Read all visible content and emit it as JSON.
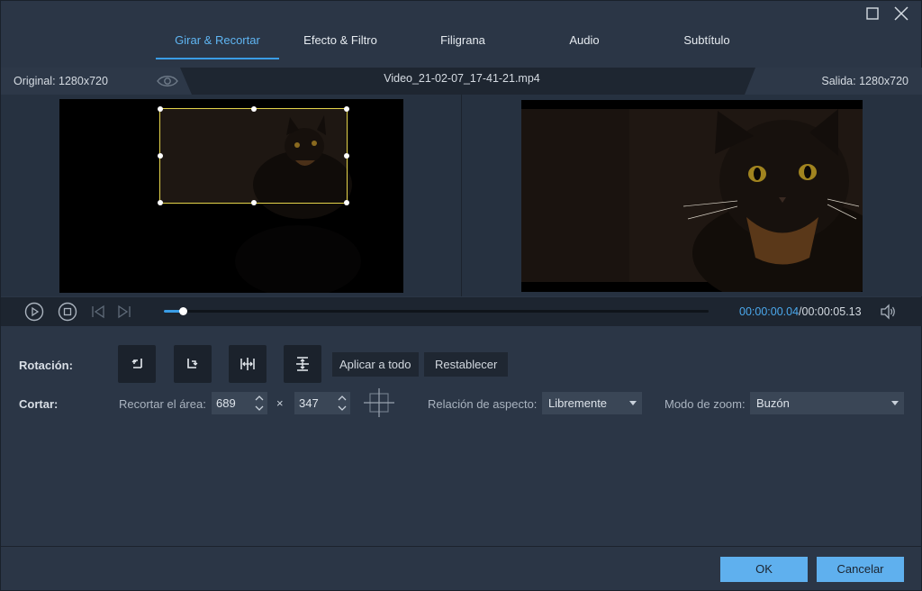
{
  "window": {
    "maximize_icon": "maximize-icon",
    "close_icon": "close-icon"
  },
  "tabs": [
    {
      "label": "Girar & Recortar",
      "active": true
    },
    {
      "label": "Efecto & Filtro",
      "active": false
    },
    {
      "label": "Filigrana",
      "active": false
    },
    {
      "label": "Audio",
      "active": false
    },
    {
      "label": "Subtítulo",
      "active": false
    }
  ],
  "info": {
    "original": "Original: 1280x720",
    "filename": "Video_21-02-07_17-41-21.mp4",
    "output": "Salida: 1280x720"
  },
  "playback": {
    "time_current": "00:00:00.04",
    "time_separator": "/",
    "time_total": "00:00:05.13",
    "progress": 0.034
  },
  "rotation": {
    "label": "Rotación:",
    "buttons": [
      "rotate-left-icon",
      "rotate-right-icon",
      "flip-horizontal-icon",
      "flip-vertical-icon"
    ],
    "apply_all": "Aplicar a todo",
    "reset": "Restablecer"
  },
  "crop": {
    "label": "Cortar:",
    "area_label": "Recortar el área:",
    "width": "689",
    "times": "×",
    "height": "347",
    "aspect_label": "Relación de aspecto:",
    "aspect_value": "Libremente",
    "zoom_label": "Modo de zoom:",
    "zoom_value": "Buzón"
  },
  "dialog": {
    "ok": "OK",
    "cancel": "Cancelar"
  },
  "colors": {
    "accent": "#3a9de6",
    "crop_border": "#e4d34a",
    "ok_button": "#5fb0ee"
  }
}
